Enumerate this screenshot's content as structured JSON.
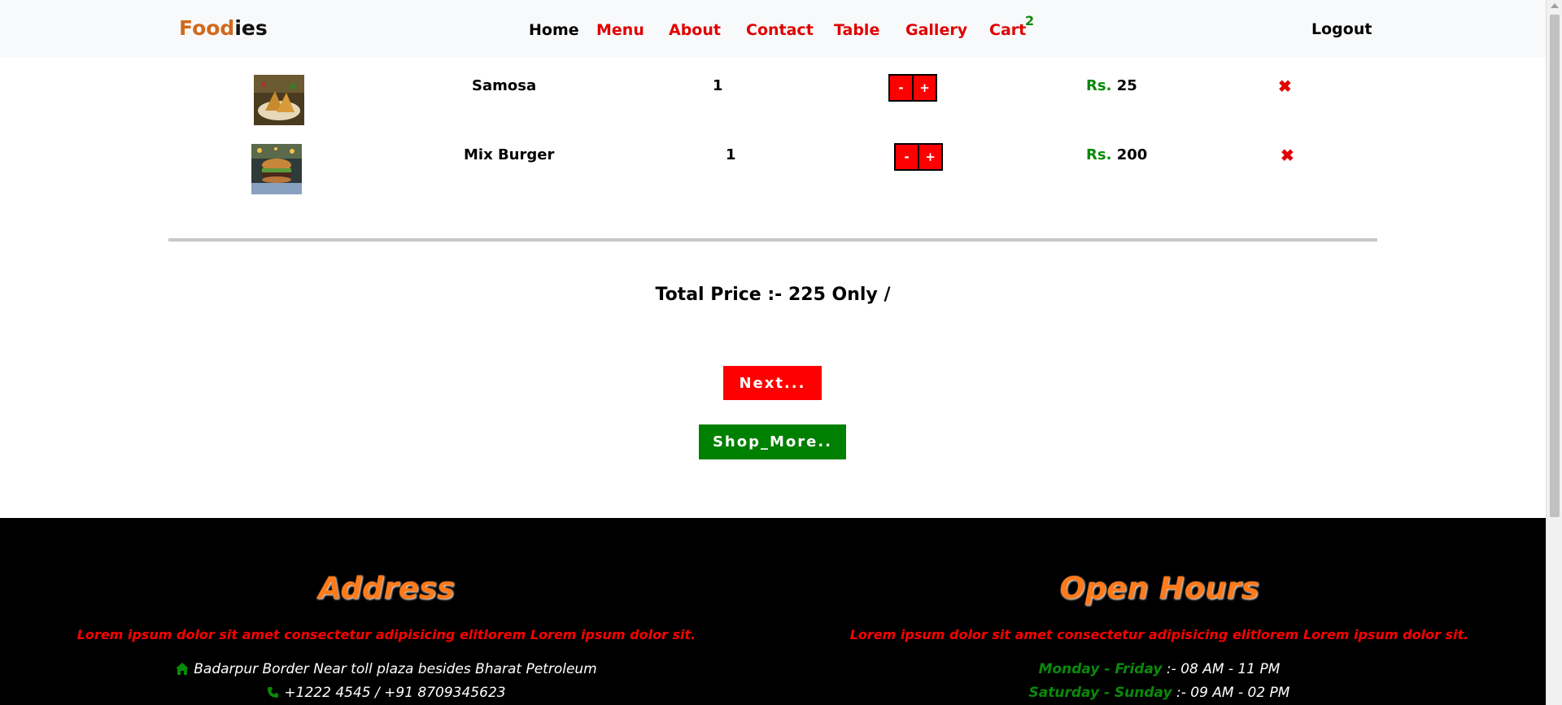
{
  "brand": {
    "part1": "Food",
    "part2": "ies"
  },
  "nav": {
    "home": "Home",
    "menu": "Menu",
    "about": "About",
    "contact": "Contact",
    "table": "Table",
    "gallery": "Gallery",
    "cart": "Cart",
    "cart_count": "2",
    "logout": "Logout"
  },
  "cart": {
    "items": [
      {
        "name": "Samosa",
        "qty": "1",
        "minus": "-",
        "plus": "+",
        "price_label": "Rs.",
        "price": "25",
        "remove": "✖"
      },
      {
        "name": "Mix Burger",
        "qty": "1",
        "minus": "-",
        "plus": "+",
        "price_label": "Rs.",
        "price": "200",
        "remove": "✖"
      }
    ],
    "total_text": "Total Price :- 225 Only /",
    "next_label": "Next...",
    "shop_more_label": "Shop_More.."
  },
  "footer": {
    "address": {
      "heading": "Address",
      "lorem": "Lorem ipsum dolor sit amet consectetur adipisicing elitlorem Lorem ipsum dolor sit.",
      "location": "Badarpur Border Near toll plaza besides Bharat Petroleum",
      "phone": "+1222 4545 / +91 8709345623"
    },
    "hours": {
      "heading": "Open Hours",
      "lorem": "Lorem ipsum dolor sit amet consectetur adipisicing elitlorem Lorem ipsum dolor sit.",
      "weekday_label": "Monday - Friday",
      "weekday_time": ":- 08 AM - 11 PM",
      "weekend_label": "Saturday - Sunday",
      "weekend_time": ":- 09 AM - 02 PM"
    }
  },
  "colors": {
    "accent_red": "#ff0000",
    "accent_green": "#008000",
    "brand_orange": "#d2691e",
    "heading_orange": "#ff7a1a"
  },
  "icons": [
    "home-icon",
    "phone-icon",
    "remove-icon",
    "samosa-image",
    "burger-image"
  ]
}
